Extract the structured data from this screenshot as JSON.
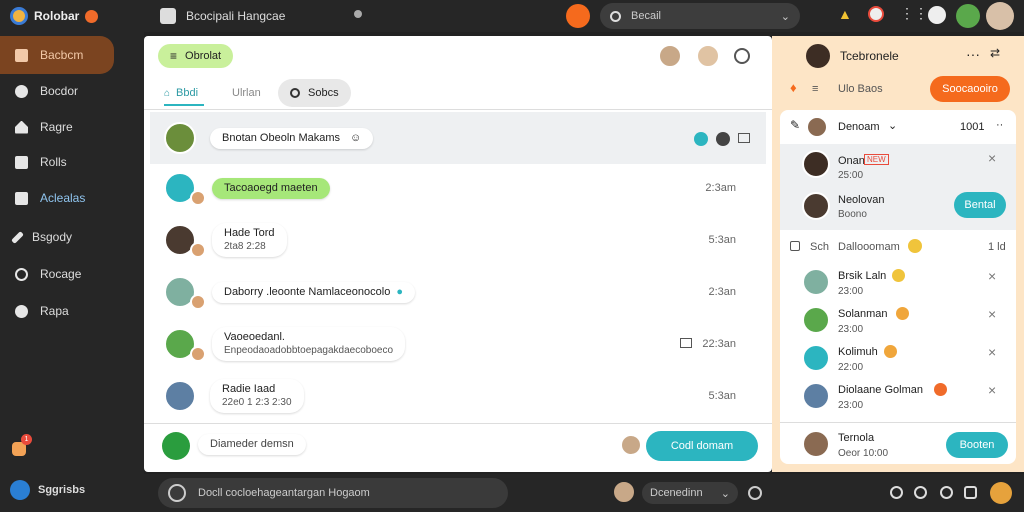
{
  "app": {
    "logo_text": "Rolobar"
  },
  "sidebar": {
    "items": [
      {
        "label": "Bacbcm",
        "icon": "calendar-icon"
      },
      {
        "label": "Bocdor",
        "icon": "chat-bubble-icon"
      },
      {
        "label": "Ragre",
        "icon": "home-icon"
      },
      {
        "label": "Rolls",
        "icon": "grid-icon"
      },
      {
        "label": "Aclealas",
        "icon": "grid-icon"
      },
      {
        "label": "Bsgody",
        "icon": "pen-icon"
      },
      {
        "label": "Rocage",
        "icon": "message-icon"
      },
      {
        "label": "Rapa",
        "icon": "settings-icon"
      }
    ],
    "notification_count": "1",
    "footer_label": "Sggrisbs"
  },
  "topbar": {
    "title": "Bcocipali Hangcae",
    "search_placeholder": "Becail"
  },
  "main": {
    "chip_label": "Obrolat",
    "tabs": [
      "Bbdi",
      "Ulrlan",
      "Sobcs"
    ],
    "rows": [
      {
        "name": "Bnotan Obeoln Makams",
        "sub": "",
        "time": ""
      },
      {
        "name": "Tacoaoegd maeten",
        "sub": "",
        "time": "2:3am"
      },
      {
        "name": "Hade Tord",
        "sub": "2ta8 2:28",
        "time": "5:3an"
      },
      {
        "name": "Daborry .leoonte Namlaceonocolo",
        "sub": "",
        "time": "2:3an"
      },
      {
        "name": "Vaoeoedanl.",
        "sub": "Enpeodaoadobbtoepagakdaecoboeco",
        "time": "22:3an"
      },
      {
        "name": "Radie Iaad",
        "sub": "22e0 1 2:3 2:30",
        "time": "5:3an"
      }
    ],
    "compose_placeholder": "Diameder demsn",
    "send_label": "Codl domam"
  },
  "right": {
    "title": "Tcebronele",
    "subtitle": "Ulo Baos",
    "action_label": "Soocaooiro",
    "section_title": "Denoam",
    "section_count": "1001",
    "featured": [
      {
        "name": "Onan",
        "tag": "NEW",
        "sub": "25:00"
      },
      {
        "name": "Neolovan",
        "sub": "Boono",
        "button": "Bental"
      }
    ],
    "group_title": "Dallooomam",
    "group_prefix": "Sch",
    "group_count": "1 ld",
    "contacts": [
      {
        "name": "Brsik Laln",
        "sub": "23:00"
      },
      {
        "name": "Solanman",
        "sub": "23:00"
      },
      {
        "name": "Kolimuh",
        "sub": "22:00"
      },
      {
        "name": "Diolaane Golman",
        "sub": "23:00"
      }
    ],
    "footer_name": "Ternola",
    "footer_sub": "Oeor 10:00",
    "footer_button": "Booten"
  },
  "bottombar": {
    "placeholder": "Docll cocloehageantargan Hogaom",
    "user_label": "Dcenedinn"
  },
  "colors": {
    "accent": "#2cb5c0",
    "orange": "#f56a1d",
    "green": "#9fe06f"
  }
}
